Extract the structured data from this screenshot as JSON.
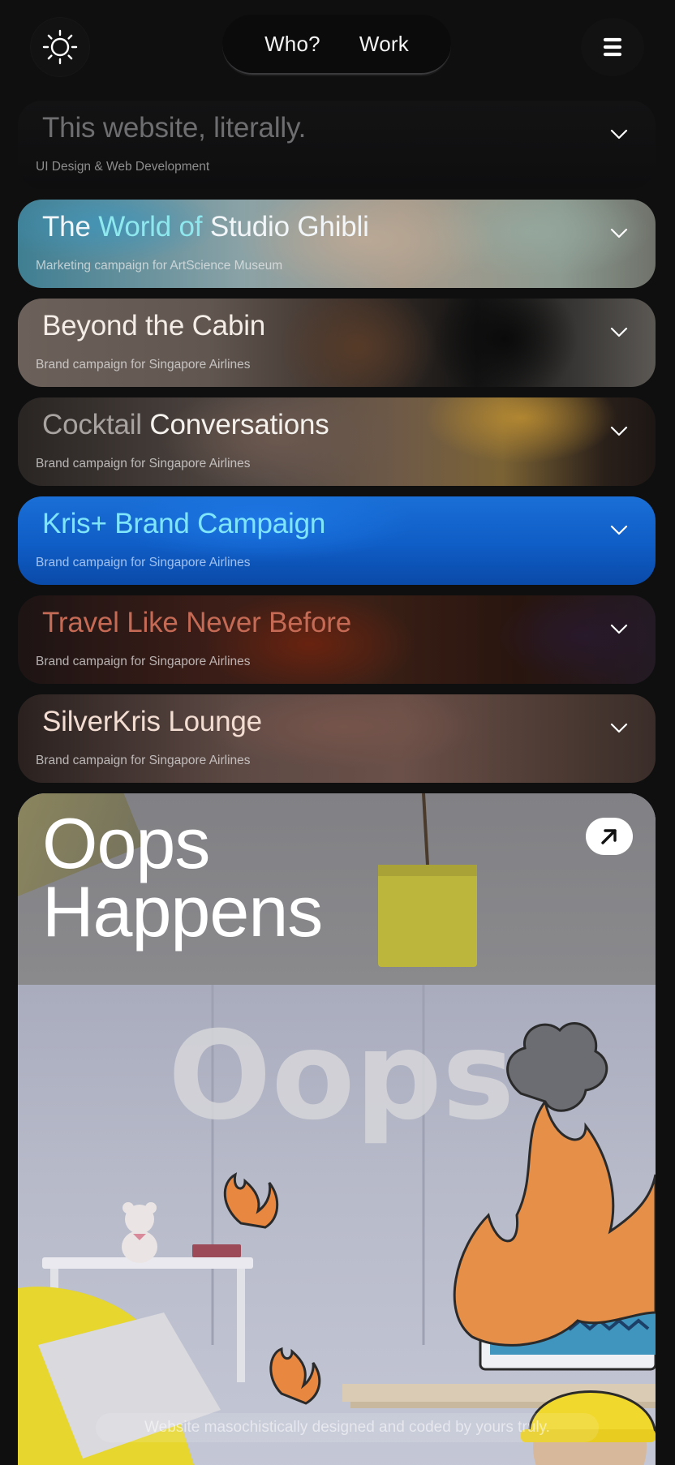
{
  "header": {
    "theme_icon": "sun-icon",
    "menu_icon": "hamburger-menu-icon",
    "nav": [
      {
        "label": "Who?"
      },
      {
        "label": "Work"
      }
    ]
  },
  "projects": [
    {
      "title_a": "This website, literally.",
      "title_b": "",
      "subtitle": "UI Design & Web Development"
    },
    {
      "title_a": "The ",
      "title_b": "World of ",
      "title_c": "Studio Ghibli",
      "subtitle": "Marketing campaign for ArtScience Museum"
    },
    {
      "title_a": "Beyond the Cabin",
      "title_b": "",
      "subtitle": "Brand campaign for Singapore Airlines"
    },
    {
      "title_a": "Cocktail ",
      "title_b": "Conversations",
      "subtitle": "Brand campaign for Singapore Airlines"
    },
    {
      "title_a": "Kris+ Brand Campaign",
      "title_b": "",
      "subtitle": "Brand campaign for Singapore Airlines"
    },
    {
      "title_a": "Travel Like Never Before",
      "title_b": "",
      "subtitle": "Brand campaign for Singapore Airlines"
    },
    {
      "title_a": "SilverKris Lounge",
      "title_b": "",
      "subtitle": "Brand campaign for Singapore Airlines"
    }
  ],
  "featured": {
    "title_line1": "Oops",
    "title_line2": "Happens",
    "scene_sign": "Oops",
    "arrow_icon": "arrow-up-right-icon",
    "footer_note": "Website masochistically designed and coded by yours truly."
  },
  "colors": {
    "background": "#0f0f10",
    "kris_blue": "#1a6fd6",
    "accent_cyan": "#7fe5fa"
  }
}
